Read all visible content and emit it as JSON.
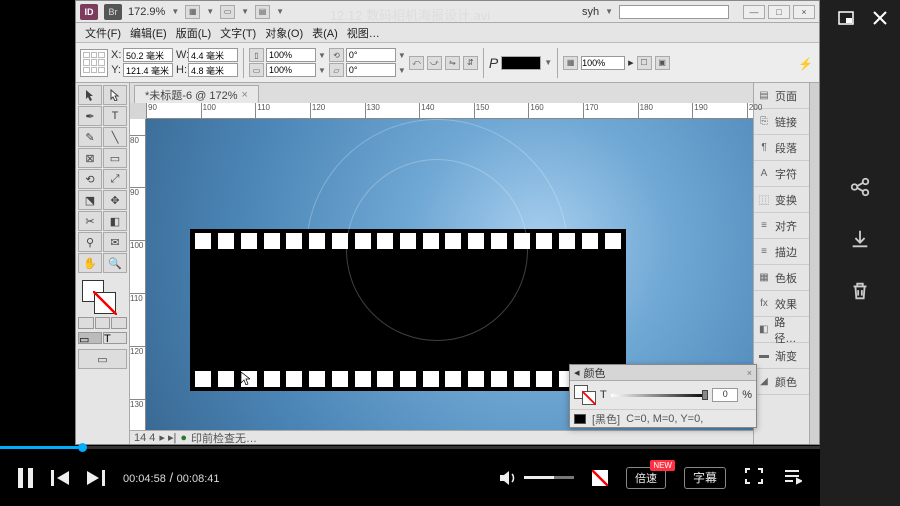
{
  "video": {
    "title": "12.12 数码相机海报设计.avi",
    "current_time": "00:04:58",
    "total_time": "00:08:41",
    "speed_label": "倍速",
    "speed_badge": "NEW",
    "subtitle_label": "字幕"
  },
  "app": {
    "logo": "ID",
    "br": "Br",
    "zoom_title": "172.9%",
    "user_label": "syh",
    "menus": [
      "文件(F)",
      "编辑(E)",
      "版面(L)",
      "文字(T)",
      "对象(O)",
      "表(A)",
      "视图…"
    ],
    "coords": {
      "x": "50.2 毫米",
      "y": "121.4 毫米",
      "w": "4.4 毫米",
      "h": "4.8 毫米"
    },
    "scale_y": "100%",
    "scale_x": "100%",
    "rotate": "0°",
    "shear": "0°",
    "stroke_pct": "100%",
    "p_label": "P",
    "doc_tab": "*未标题-6 @ 172%",
    "ruler_h": [
      "90",
      "100",
      "110",
      "120",
      "130",
      "140",
      "150",
      "160",
      "170",
      "180",
      "190",
      "200"
    ],
    "ruler_v": [
      "80",
      "90",
      "100",
      "110",
      "120",
      "130"
    ],
    "panels": [
      "页面",
      "链接",
      "段落",
      "字符",
      "变换",
      "对齐",
      "描边",
      "色板",
      "效果",
      "路径…",
      "渐变",
      "颜色"
    ],
    "status_left": "14 4",
    "status_right": "印前检查无…"
  },
  "color_panel": {
    "title": "颜色",
    "t_label": "T",
    "value": "0",
    "pct": "%",
    "name": "[黑色]",
    "formula": "C=0, M=0, Y=0,",
    "close": "×"
  }
}
